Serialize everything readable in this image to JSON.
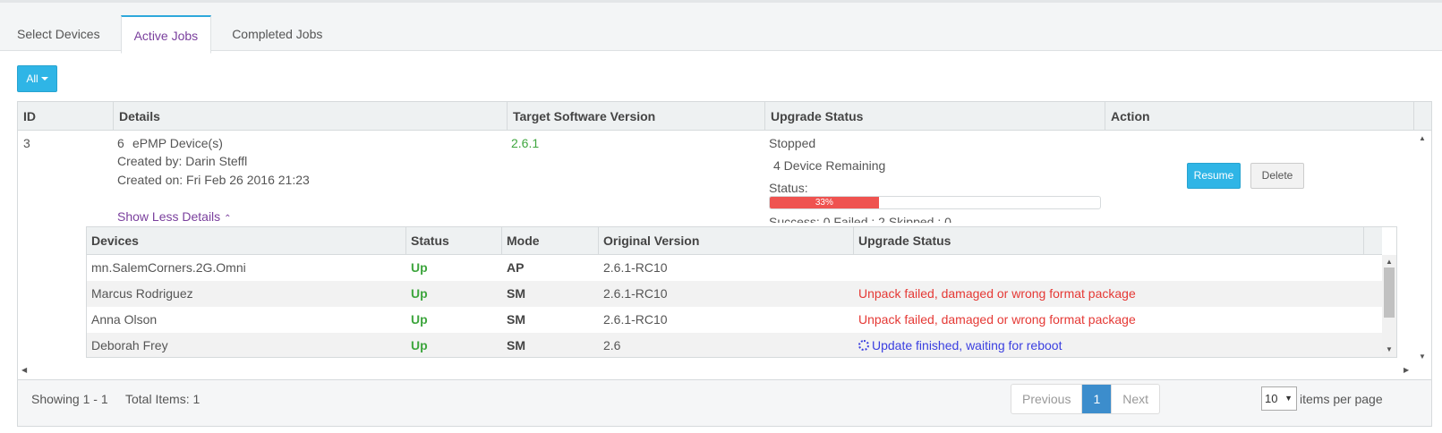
{
  "tabs": [
    "Select Devices",
    "Active Jobs",
    "Completed Jobs"
  ],
  "filter": {
    "label": "All"
  },
  "main_table": {
    "headers": [
      "ID",
      "Details",
      "Target Software Version",
      "Upgrade Status",
      "Action"
    ],
    "row": {
      "id": "3",
      "device_count": "6",
      "device_type": "ePMP Device(s)",
      "created_by": "Created by: Darin Steffl",
      "created_on": "Created on: Fri Feb 26 2016 21:23",
      "show_less": "Show Less Details",
      "target_version": "2.6.1",
      "status": "Stopped",
      "remaining": "4 Device Remaining",
      "status_label": "Status:",
      "progress": 0.33,
      "progress_text": "33%",
      "summary_partial": "Success: 0   Failed : 2   Skipped : 0",
      "resume_label": "Resume",
      "delete_label": "Delete"
    }
  },
  "sub_table": {
    "headers": [
      "Devices",
      "Status",
      "Mode",
      "Original Version",
      "Upgrade Status"
    ],
    "rows": [
      {
        "device": "mn.SalemCorners.2G.Omni",
        "status": "Up",
        "mode": "AP",
        "version": "2.6.1-RC10",
        "upgrade": ""
      },
      {
        "device": "Marcus Rodriguez",
        "status": "Up",
        "mode": "SM",
        "version": "2.6.1-RC10",
        "upgrade": "Unpack failed, damaged or wrong format package"
      },
      {
        "device": "Anna Olson",
        "status": "Up",
        "mode": "SM",
        "version": "2.6.1-RC10",
        "upgrade": "Unpack failed, damaged or wrong format package"
      },
      {
        "device": "Deborah Frey",
        "status": "Up",
        "mode": "SM",
        "version": "2.6",
        "upgrade": "Update finished, waiting for reboot"
      }
    ]
  },
  "footer": {
    "showing": "Showing 1 - 1",
    "total": "Total Items: 1",
    "previous": "Previous",
    "page": "1",
    "next": "Next",
    "per_page_value": "10",
    "per_page_label": "items per page"
  },
  "colors": {
    "accent": "#2fb5e6",
    "link": "#7a3f9d",
    "success": "#3fa63f",
    "error": "#e53935",
    "info": "#3b3fe0",
    "progress": "#ef5350"
  }
}
